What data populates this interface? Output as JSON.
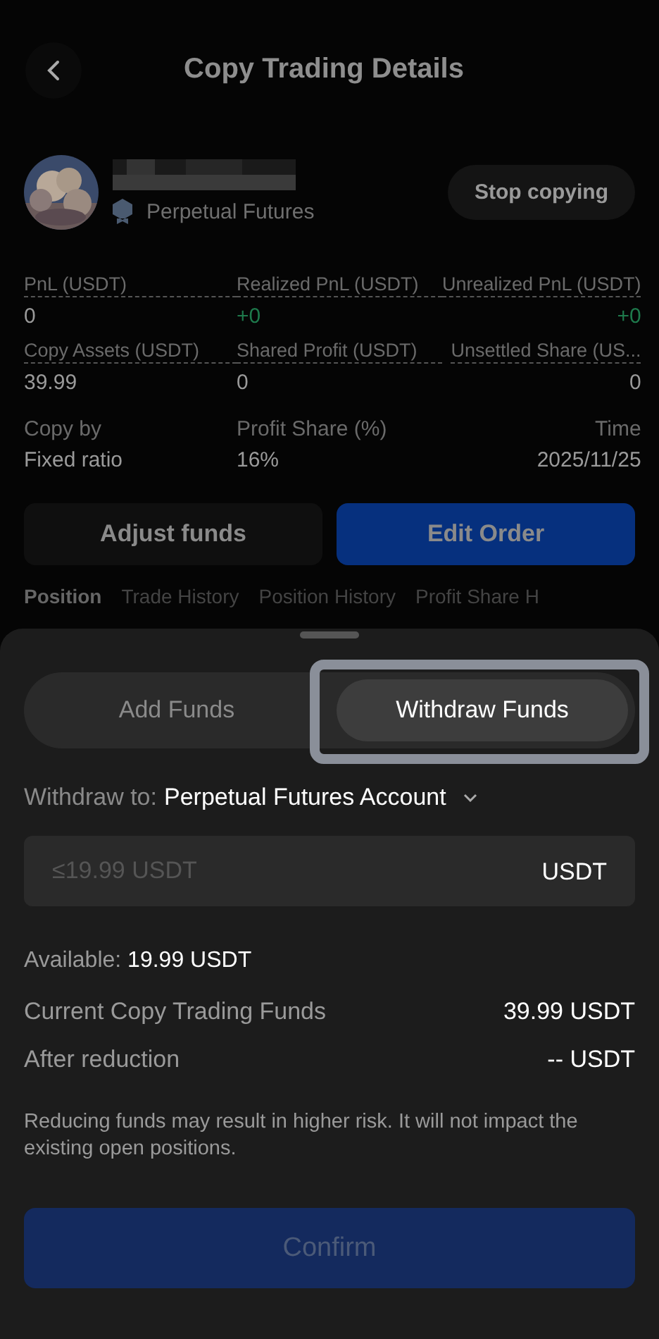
{
  "header": {
    "title": "Copy Trading Details"
  },
  "profile": {
    "subtitle": "Perpetual Futures",
    "action": "Stop copying"
  },
  "stats": [
    {
      "label": "PnL (USDT)",
      "value": "0",
      "underlined": true,
      "color": "#9a9a9a"
    },
    {
      "label": "Realized PnL (USDT)",
      "value": "+0",
      "underlined": true,
      "color": "#1e7a4c"
    },
    {
      "label": "Unrealized PnL (USDT)",
      "value": "+0",
      "underlined": true,
      "color": "#1e7a4c"
    },
    {
      "label": "Copy Assets (USDT)",
      "value": "39.99",
      "underlined": true,
      "color": "#9a9a9a"
    },
    {
      "label": "Shared Profit (USDT)",
      "value": "0",
      "underlined": true,
      "color": "#9a9a9a"
    },
    {
      "label": "Unsettled Share (US...",
      "value": "0",
      "underlined": true,
      "color": "#9a9a9a"
    },
    {
      "label": "Copy by",
      "value": "Fixed ratio",
      "underlined": false,
      "color": "#9a9a9a"
    },
    {
      "label": "Profit Share (%)",
      "value": "16%",
      "underlined": false,
      "color": "#9a9a9a"
    },
    {
      "label": "Time",
      "value": "2025/11/25",
      "underlined": false,
      "color": "#9a9a9a"
    }
  ],
  "actions": [
    {
      "label": "Adjust funds",
      "kind": "secondary"
    },
    {
      "label": "Edit Order",
      "kind": "primary"
    }
  ],
  "tabs": [
    {
      "label": "Position",
      "selected": true
    },
    {
      "label": "Trade History",
      "selected": false
    },
    {
      "label": "Position History",
      "selected": false
    },
    {
      "label": "Profit Share H",
      "selected": false
    }
  ],
  "sheet": {
    "modes": [
      {
        "label": "Add Funds",
        "selected": false
      },
      {
        "label": "Withdraw Funds",
        "selected": true
      }
    ],
    "destination": {
      "label": "Withdraw to:",
      "value": "Perpetual Futures Account"
    },
    "amount": {
      "placeholder": "≤19.99 USDT",
      "unit": "USDT"
    },
    "available": {
      "label": "Available:",
      "value": "19.99 USDT"
    },
    "summary": [
      {
        "label": "Current Copy Trading Funds",
        "value": "39.99 USDT"
      },
      {
        "label": "After reduction",
        "value": "-- USDT"
      }
    ],
    "note": "Reducing funds may result in higher risk. It will not impact the existing open positions.",
    "confirm": {
      "label": "Confirm",
      "disabled": true
    }
  }
}
